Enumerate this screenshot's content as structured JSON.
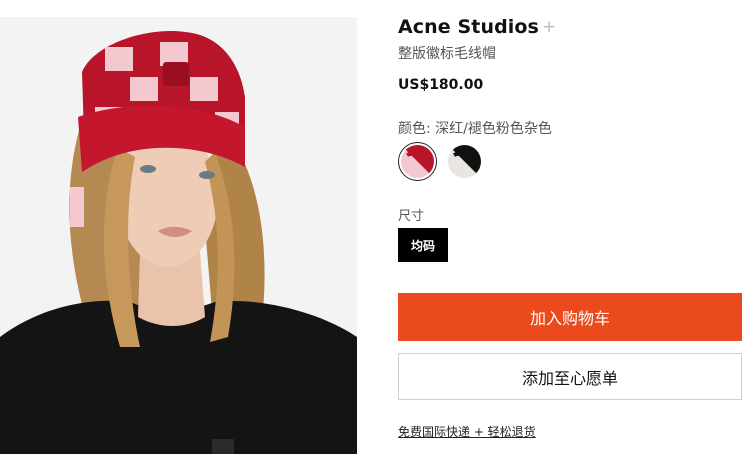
{
  "product": {
    "brand": "Acne Studios",
    "plus_symbol": "+",
    "name": "整版徽标毛线帽",
    "price": "US$180.00"
  },
  "color": {
    "label": "颜色: 深红/褪色粉色杂色",
    "swatches": [
      {
        "name": "deep-red-pink",
        "colors": [
          "#b8142a",
          "#f3c9cf"
        ],
        "selected": true
      },
      {
        "name": "black-white",
        "colors": [
          "#111111",
          "#e9e6df"
        ],
        "selected": false
      }
    ]
  },
  "size": {
    "label": "尺寸",
    "selected": "均码"
  },
  "actions": {
    "add_to_cart": "加入购物车",
    "add_to_wishlist": "添加至心愿单",
    "accent_color": "#ea4a1c"
  },
  "shipping_note": "免费国际快递 + 轻松退货"
}
